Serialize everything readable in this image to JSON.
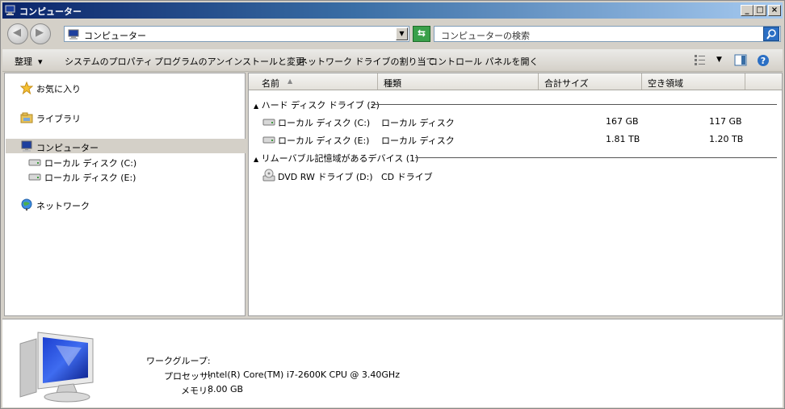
{
  "window": {
    "title": "コンピューター",
    "controls": {
      "minimize": "_",
      "maximize": "□",
      "close": "×"
    }
  },
  "address": {
    "path": "コンピューター",
    "search_placeholder": "コンピューターの検索"
  },
  "toolbar": {
    "organize": "整理",
    "system_properties": "システムのプロパティ",
    "uninstall": "プログラムのアンインストールと変更",
    "map_drive": "ネットワーク ドライブの割り当て",
    "control_panel": "コントロール パネルを開く"
  },
  "navpane": {
    "favorites": "お気に入り",
    "libraries": "ライブラリ",
    "computer": "コンピューター",
    "drive_c": "ローカル ディスク (C:)",
    "drive_e": "ローカル ディスク (E:)",
    "network": "ネットワーク"
  },
  "columns": {
    "name": "名前",
    "type": "種類",
    "total_size": "合計サイズ",
    "free_space": "空き領域"
  },
  "groups": {
    "hdd": "ハード ディスク ドライブ (2)",
    "removable": "リムーバブル記憶域があるデバイス (1)"
  },
  "drives": [
    {
      "name": "ローカル ディスク (C:)",
      "type": "ローカル ディスク",
      "total": "167 GB",
      "free": "117 GB"
    },
    {
      "name": "ローカル ディスク (E:)",
      "type": "ローカル ディスク",
      "total": "1.81 TB",
      "free": "1.20 TB"
    }
  ],
  "removable": [
    {
      "name": "DVD RW ドライブ (D:)",
      "type": "CD ドライブ"
    }
  ],
  "details": {
    "workgroup_label": "ワークグループ:",
    "workgroup_value": "",
    "processor_label": "プロセッサ:",
    "processor_value": "Intel(R) Core(TM) i7-2600K CPU @ 3.40GHz",
    "memory_label": "メモリ:",
    "memory_value": "8.00 GB"
  }
}
